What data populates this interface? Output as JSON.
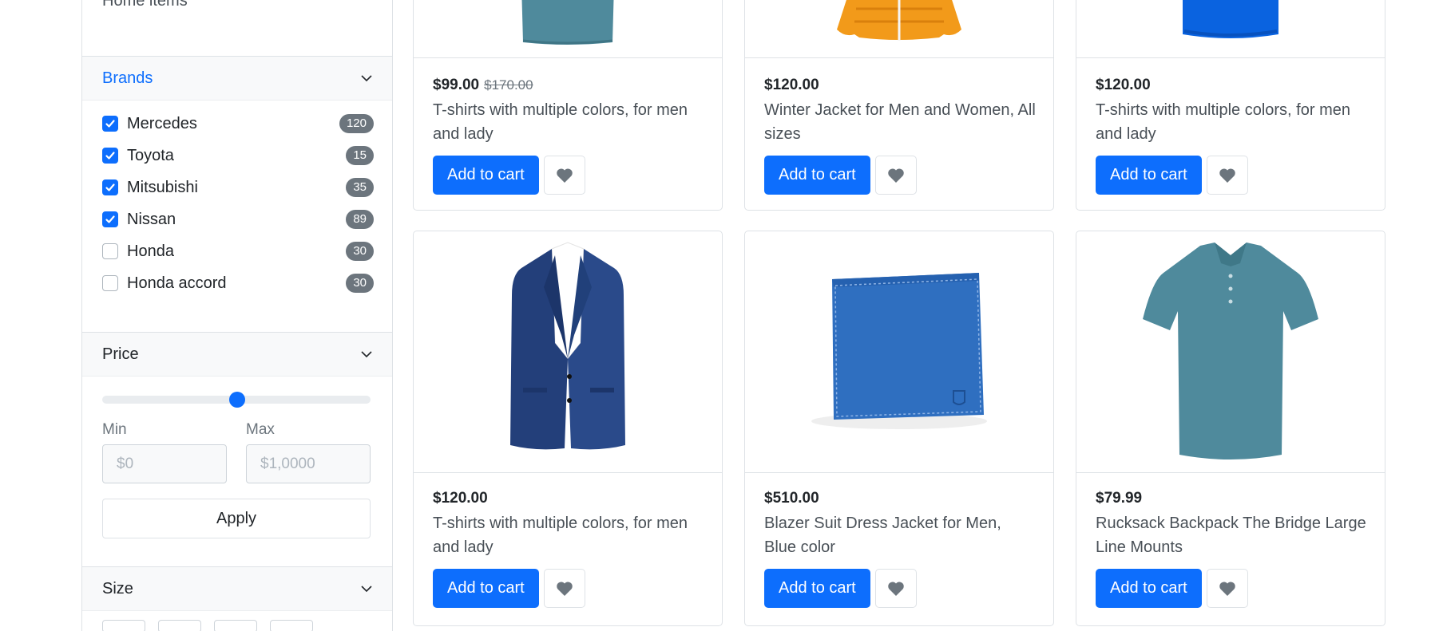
{
  "sidebar": {
    "categories_tail": "Home items",
    "brands": {
      "title": "Brands",
      "items": [
        {
          "label": "Mercedes",
          "count": "120",
          "checked": true
        },
        {
          "label": "Toyota",
          "count": "15",
          "checked": true
        },
        {
          "label": "Mitsubishi",
          "count": "35",
          "checked": true
        },
        {
          "label": "Nissan",
          "count": "89",
          "checked": true
        },
        {
          "label": "Honda",
          "count": "30",
          "checked": false
        },
        {
          "label": "Honda accord",
          "count": "30",
          "checked": false
        }
      ]
    },
    "price": {
      "title": "Price",
      "slider_value": 0.5,
      "min_label": "Min",
      "max_label": "Max",
      "min_placeholder": "$0",
      "max_placeholder": "$1,0000",
      "apply_label": "Apply"
    },
    "size": {
      "title": "Size"
    }
  },
  "products": [
    {
      "price": "$99.00",
      "old_price": "$170.00",
      "title": "T-shirts with multiple colors, for men and lady",
      "cart_label": "Add to cart",
      "image": "teal-polo-shirt"
    },
    {
      "price": "$120.00",
      "old_price": "",
      "title": "Winter Jacket for Men and Women, All sizes",
      "cart_label": "Add to cart",
      "image": "orange-puffer-jacket"
    },
    {
      "price": "$120.00",
      "old_price": "",
      "title": "T-shirts with multiple colors, for men and lady",
      "cart_label": "Add to cart",
      "image": "blue-tshirt"
    },
    {
      "price": "$120.00",
      "old_price": "",
      "title": "T-shirts with multiple colors, for men and lady",
      "cart_label": "Add to cart",
      "image": "navy-blazer"
    },
    {
      "price": "$510.00",
      "old_price": "",
      "title": "Blazer Suit Dress Jacket for Men, Blue color",
      "cart_label": "Add to cart",
      "image": "blue-wallet"
    },
    {
      "price": "$79.99",
      "old_price": "",
      "title": "Rucksack Backpack The Bridge Large Line Mounts",
      "cart_label": "Add to cart",
      "image": "teal-polo-shirt"
    }
  ],
  "colors": {
    "primary": "#0d6efd",
    "badge": "#6c757d",
    "border": "#dee2e6",
    "muted_text": "#6c757d"
  }
}
